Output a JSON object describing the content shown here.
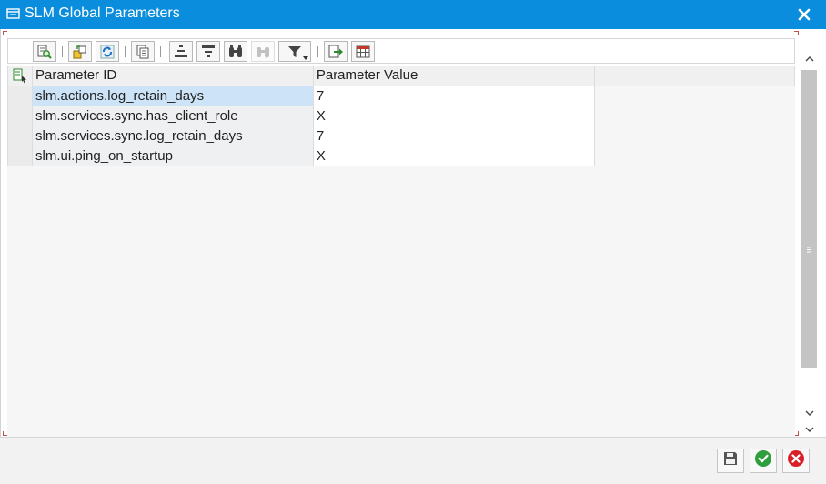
{
  "window": {
    "title": "SLM Global Parameters",
    "accent_color": "#0a8ddc",
    "icon": "dialog-window-icon",
    "close_icon": "close-x-icon"
  },
  "toolbar": {
    "buttons": [
      {
        "icon": "details-magnifier-icon",
        "enabled": true
      },
      {
        "icon": "change-display-icon",
        "enabled": true
      },
      {
        "icon": "refresh-icon",
        "enabled": true
      },
      {
        "icon": "copy-clipboard-icon",
        "enabled": true
      },
      {
        "icon": "sort-ascending-icon",
        "enabled": true
      },
      {
        "icon": "sort-descending-icon",
        "enabled": true
      },
      {
        "icon": "find-binoculars-icon",
        "enabled": true
      },
      {
        "icon": "find-next-binoculars-icon",
        "enabled": false
      },
      {
        "icon": "filter-funnel-icon",
        "enabled": true
      },
      {
        "icon": "export-icon",
        "enabled": true
      },
      {
        "icon": "layout-grid-icon",
        "enabled": true
      }
    ]
  },
  "table": {
    "columns": [
      "Parameter ID",
      "Parameter Value"
    ],
    "rows": [
      {
        "id": "slm.actions.log_retain_days",
        "value": "7"
      },
      {
        "id": "slm.services.sync.has_client_role",
        "value": "X"
      },
      {
        "id": "slm.services.sync.log_retain_days",
        "value": "7"
      },
      {
        "id": "slm.ui.ping_on_startup",
        "value": "X"
      }
    ],
    "selected_row": 0,
    "selected_color": "#cde3f7"
  },
  "footer": {
    "buttons": [
      {
        "icon": "save-disk-icon",
        "color": "#555555"
      },
      {
        "icon": "confirm-check-icon",
        "color": "#2e9e3e"
      },
      {
        "icon": "cancel-x-icon",
        "color": "#d8202a"
      }
    ]
  }
}
